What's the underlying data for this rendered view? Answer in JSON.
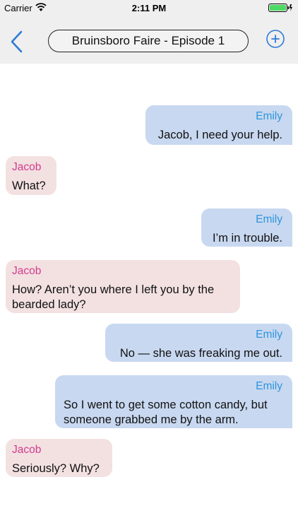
{
  "status": {
    "carrier": "Carrier",
    "time": "2:11 PM"
  },
  "nav": {
    "title": "Bruinsboro Faire - Episode 1"
  },
  "colors": {
    "accent": "#2e7bd6",
    "outgoing_bubble": "#c8d8f0",
    "incoming_bubble": "#f3e1e2",
    "outgoing_sender": "#2e95dd",
    "incoming_sender": "#d23b8c",
    "battery": "#4cd964"
  },
  "icons": {
    "back": "chevron-left-icon",
    "add": "plus-circle-icon",
    "wifi": "wifi-icon",
    "battery": "battery-icon"
  },
  "messages": [
    {
      "sender": "Emily",
      "text": "Jacob, I need your help.",
      "direction": "outgoing"
    },
    {
      "sender": "Jacob",
      "text": "What?",
      "direction": "incoming"
    },
    {
      "sender": "Emily",
      "text": "I’m in trouble.",
      "direction": "outgoing"
    },
    {
      "sender": "Jacob",
      "text": "How? Aren’t you where I left you by the bearded lady?",
      "direction": "incoming"
    },
    {
      "sender": "Emily",
      "text": "No — she was freaking me out.",
      "direction": "outgoing"
    },
    {
      "sender": "Emily",
      "text": "So I went to get some cotton candy, but someone grabbed me by the arm.",
      "direction": "outgoing"
    },
    {
      "sender": "Jacob",
      "text": "Seriously? Why?",
      "direction": "incoming"
    }
  ]
}
